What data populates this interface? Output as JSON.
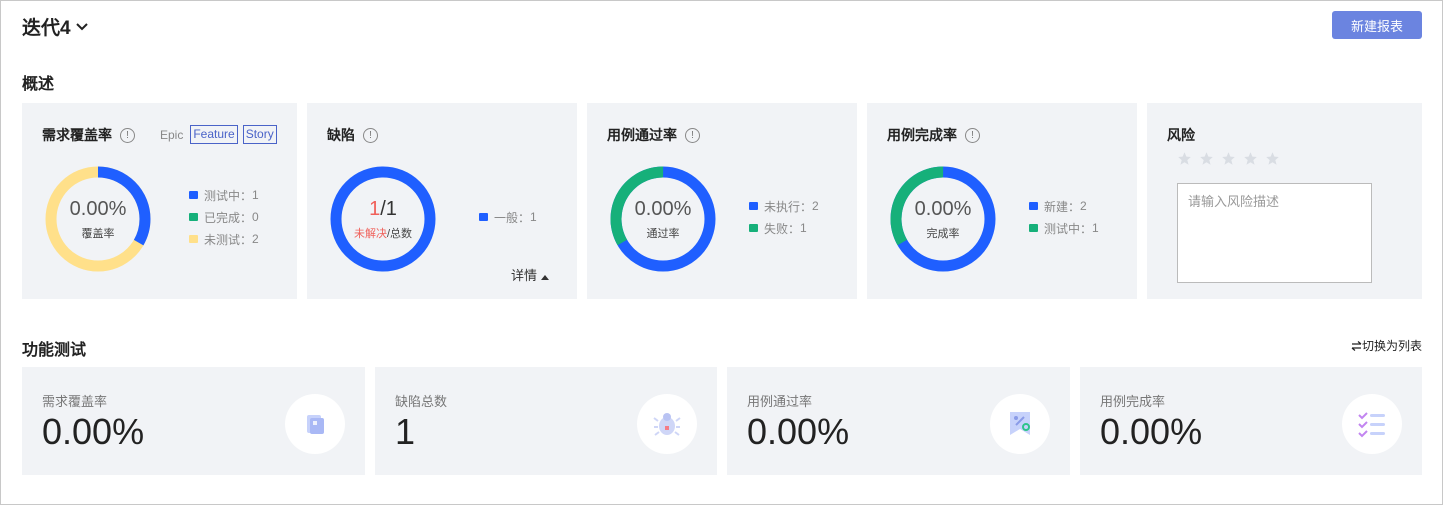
{
  "header": {
    "title": "迭代4",
    "new_report_button": "新建报表"
  },
  "overview": {
    "section_title": "概述",
    "coverage_card": {
      "title": "需求覆盖率",
      "tags": {
        "epic": "Epic",
        "feature": "Feature",
        "story": "Story"
      },
      "donut_value": "0.00%",
      "donut_label": "覆盖率",
      "legend": [
        {
          "label": "测试中",
          "value": "1",
          "color": "#1f5fff"
        },
        {
          "label": "已完成",
          "value": "0",
          "color": "#16b07a"
        },
        {
          "label": "未测试",
          "value": "2",
          "color": "#ffe08a"
        }
      ]
    },
    "defect_card": {
      "title": "缺陷",
      "unresolved": "1",
      "total": "1",
      "label_unresolved": "未解决",
      "label_total": "总数",
      "legend": [
        {
          "label": "一般",
          "value": "1",
          "color": "#1f5fff"
        }
      ],
      "details_link": "详情"
    },
    "pass_rate_card": {
      "title": "用例通过率",
      "donut_value": "0.00%",
      "donut_label": "通过率",
      "legend": [
        {
          "label": "未执行",
          "value": "2",
          "color": "#1f5fff"
        },
        {
          "label": "失败",
          "value": "1",
          "color": "#16b07a"
        }
      ]
    },
    "completion_card": {
      "title": "用例完成率",
      "donut_value": "0.00%",
      "donut_label": "完成率",
      "legend": [
        {
          "label": "新建",
          "value": "2",
          "color": "#1f5fff"
        },
        {
          "label": "测试中",
          "value": "1",
          "color": "#16b07a"
        }
      ]
    },
    "risk_card": {
      "title": "风险",
      "rating": 0,
      "rating_max": 5,
      "placeholder": "请输入风险描述"
    }
  },
  "functional": {
    "section_title": "功能测试",
    "switch_link": "切换为列表",
    "stats": [
      {
        "label": "需求覆盖率",
        "value": "0.00%",
        "icon": "document-icon"
      },
      {
        "label": "缺陷总数",
        "value": "1",
        "icon": "bug-icon"
      },
      {
        "label": "用例通过率",
        "value": "0.00%",
        "icon": "percent-ribbon-icon"
      },
      {
        "label": "用例完成率",
        "value": "0.00%",
        "icon": "checklist-icon"
      }
    ]
  }
}
